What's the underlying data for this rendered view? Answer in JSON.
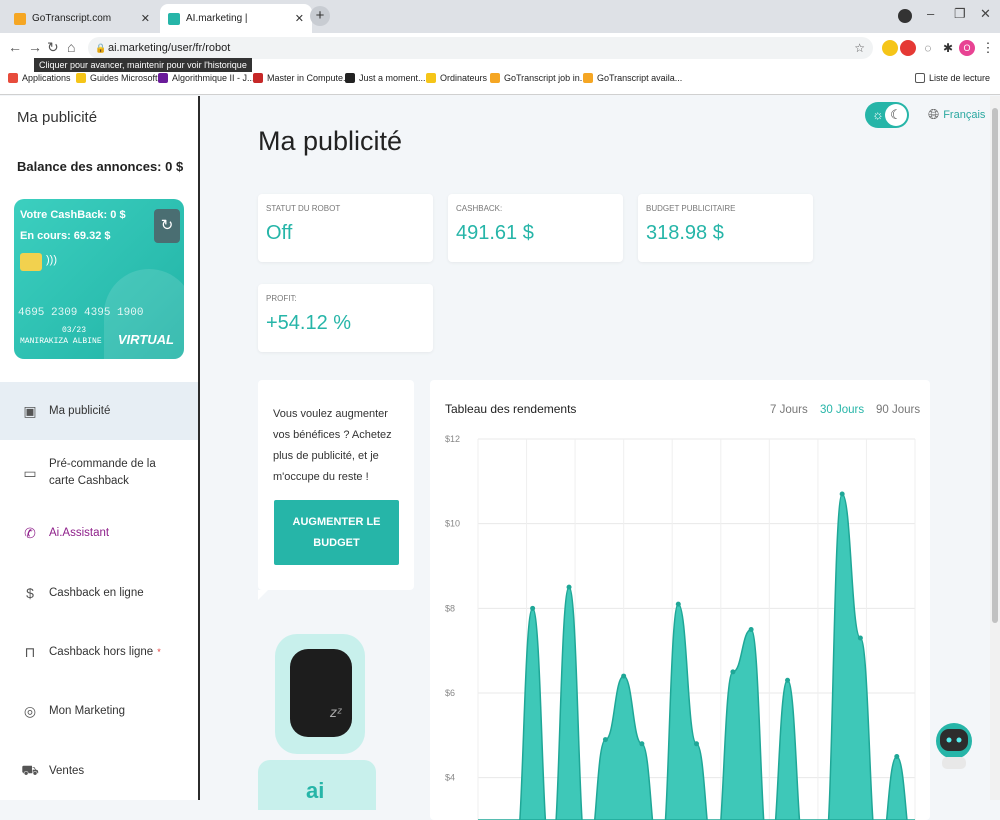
{
  "browser": {
    "tabs": [
      {
        "title": "GoTranscript.com",
        "active": false,
        "favicon_color": "#f5a623"
      },
      {
        "title": "AI.marketing |",
        "active": true,
        "favicon_color": "#26b5a8"
      }
    ],
    "url": "ai.marketing/user/fr/robot",
    "tooltip": "Cliquer pour avancer, maintenir pour voir l'historique",
    "bookmarks": [
      {
        "label": "Applications"
      },
      {
        "label": "Guides Microsoft"
      },
      {
        "label": "Algorithmique II - J..."
      },
      {
        "label": "Master in Compute..."
      },
      {
        "label": "Just a moment..."
      },
      {
        "label": "Ordinateurs"
      },
      {
        "label": "GoTranscript job in..."
      },
      {
        "label": "GoTranscript availa..."
      }
    ],
    "reading_list": "Liste de lecture"
  },
  "sidebar": {
    "title": "Ma publicité",
    "balance": "Balance des annonces: 0 $",
    "card": {
      "cashback": "Votre CashBack: 0 $",
      "en_cours": "En cours: 69.32 $",
      "number": "4695 2309 4395 1900",
      "expiry": "03/23",
      "holder": "MANIRAKIZA ALBINE",
      "type": "VIRTUAL"
    },
    "menu": [
      {
        "label": "Ma publicité",
        "icon": "id-badge-icon"
      },
      {
        "label": "Pré-commande de la carte Cashback",
        "icon": "card-icon"
      },
      {
        "label": "Ai.Assistant",
        "icon": "phone-icon"
      },
      {
        "label": "Cashback en ligne",
        "icon": "dollar-circle-icon"
      },
      {
        "label": "Cashback hors ligne",
        "icon": "bag-icon",
        "star": "*"
      },
      {
        "label": "Mon Marketing",
        "icon": "target-icon"
      },
      {
        "label": "Ventes",
        "icon": "cart-icon"
      }
    ]
  },
  "main": {
    "title": "Ma publicité",
    "language": "Français",
    "stats": [
      {
        "label": "STATUT DU ROBOT",
        "value": "Off"
      },
      {
        "label": "CASHBACK:",
        "value": "491.61 $"
      },
      {
        "label": "BUDGET PUBLICITAIRE",
        "value": "318.98 $"
      },
      {
        "label": "PROFIT:",
        "value": "+54.12 %"
      }
    ],
    "promo": {
      "text": "Vous voulez augmenter vos bénéfices ? Achetez plus de publicité, et je m'occupe du reste !",
      "button": "AUGMENTER LE BUDGET"
    },
    "chart": {
      "title": "Tableau des rendements",
      "ranges": [
        "7 Jours",
        "30 Jours",
        "90 Jours"
      ],
      "active_range": "30 Jours"
    }
  },
  "chart_data": {
    "type": "area",
    "title": "Tableau des rendements",
    "ylabel": "",
    "xlabel": "",
    "ylim": [
      3,
      12
    ],
    "yticks": [
      "$12",
      "$10",
      "$8",
      "$6",
      "$4"
    ],
    "color": "#3ec8b8",
    "points": [
      {
        "x": 0,
        "y": 0
      },
      {
        "x": 1,
        "y": 0
      },
      {
        "x": 2,
        "y": 0
      },
      {
        "x": 3,
        "y": 8.0
      },
      {
        "x": 4,
        "y": 0
      },
      {
        "x": 5,
        "y": 8.5
      },
      {
        "x": 6,
        "y": 0
      },
      {
        "x": 7,
        "y": 4.9
      },
      {
        "x": 8,
        "y": 6.4
      },
      {
        "x": 9,
        "y": 4.8
      },
      {
        "x": 10,
        "y": 0
      },
      {
        "x": 11,
        "y": 8.1
      },
      {
        "x": 12,
        "y": 4.8
      },
      {
        "x": 13,
        "y": 0
      },
      {
        "x": 14,
        "y": 6.5
      },
      {
        "x": 15,
        "y": 7.5
      },
      {
        "x": 16,
        "y": 0
      },
      {
        "x": 17,
        "y": 6.3
      },
      {
        "x": 18,
        "y": 0
      },
      {
        "x": 19,
        "y": 0
      },
      {
        "x": 20,
        "y": 10.7
      },
      {
        "x": 21,
        "y": 7.3
      },
      {
        "x": 22,
        "y": 0
      },
      {
        "x": 23,
        "y": 4.5
      },
      {
        "x": 24,
        "y": 0
      }
    ]
  }
}
